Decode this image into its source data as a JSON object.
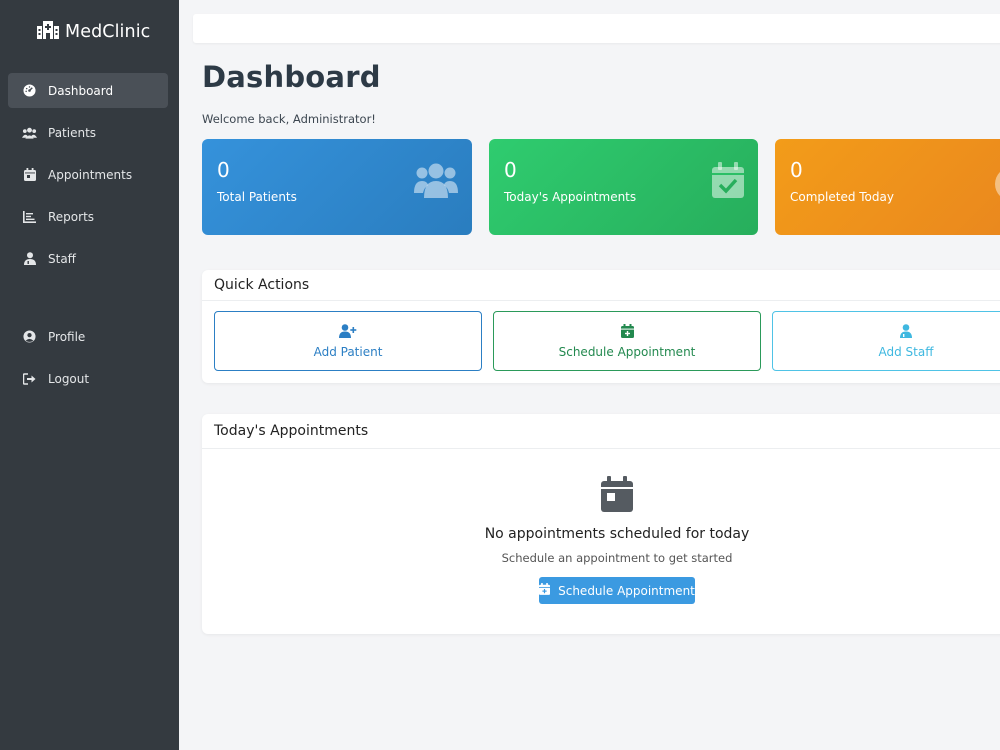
{
  "brand": {
    "name": "MedClinic",
    "icon": "hospital-icon"
  },
  "sidebar": {
    "items": [
      {
        "label": "Dashboard",
        "icon": "dashboard-icon",
        "active": true
      },
      {
        "label": "Patients",
        "icon": "users-icon"
      },
      {
        "label": "Appointments",
        "icon": "calendar-icon"
      },
      {
        "label": "Reports",
        "icon": "chart-icon"
      },
      {
        "label": "Staff",
        "icon": "staff-icon"
      },
      {
        "label": "Profile",
        "icon": "user-circle-icon"
      },
      {
        "label": "Logout",
        "icon": "logout-icon"
      }
    ]
  },
  "page": {
    "title": "Dashboard",
    "welcome": "Welcome back, Administrator!"
  },
  "stats": [
    {
      "value": "0",
      "label": "Total Patients",
      "color": "#3592db",
      "icon": "users-icon"
    },
    {
      "value": "0",
      "label": "Today's Appointments",
      "color": "#2fcc6f",
      "icon": "calendar-check-icon"
    },
    {
      "value": "0",
      "label": "Completed Today",
      "color": "#f39c19",
      "icon": "check-circle-icon"
    }
  ],
  "quick_actions": {
    "title": "Quick Actions",
    "buttons": [
      {
        "label": "Add Patient",
        "icon": "user-plus-icon",
        "color": "#2c7fc4"
      },
      {
        "label": "Schedule Appointment",
        "icon": "calendar-plus-icon",
        "color": "#23894f"
      },
      {
        "label": "Add Staff",
        "icon": "user-md-icon",
        "color": "#3fb8e0"
      }
    ]
  },
  "appointments": {
    "title": "Today's Appointments",
    "empty_title": "No appointments scheduled for today",
    "empty_subtitle": "Schedule an appointment to get started",
    "cta_label": "Schedule Appointment"
  }
}
